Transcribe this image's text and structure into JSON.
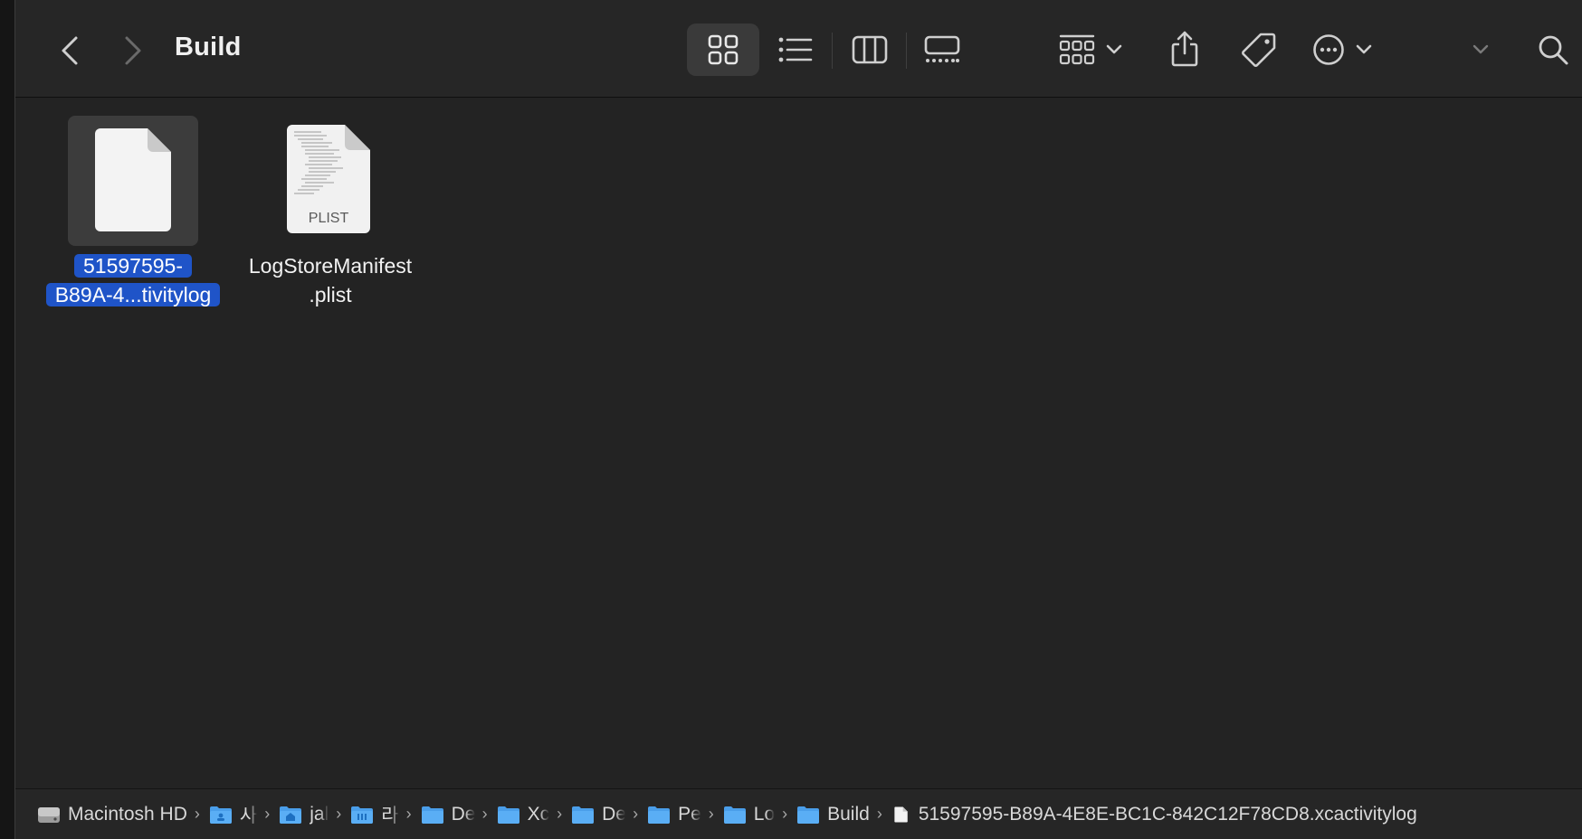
{
  "window": {
    "title": "Build"
  },
  "toolbar": {
    "icons": {
      "back": "chevron-left-icon",
      "forward": "chevron-right-icon",
      "icon_view": "grid-icon",
      "list_view": "list-icon",
      "column_view": "columns-icon",
      "gallery_view": "gallery-icon",
      "group": "group-icon",
      "share": "share-icon",
      "tags": "tag-icon",
      "action": "ellipsis-circle-icon",
      "more": "chevron-down-icon",
      "search": "search-icon"
    },
    "active_view": "icon_view"
  },
  "files": [
    {
      "name_line1": "51597595-",
      "name_line2": "B89A-4...tivitylog",
      "kind": "blank-document",
      "selected": true
    },
    {
      "name_line1": "LogStoreManifest",
      "name_line2": ".plist",
      "kind": "plist-document",
      "badge": "PLIST",
      "selected": false
    }
  ],
  "pathbar": {
    "items": [
      {
        "label": "Macintosh HD",
        "icon": "hard-drive-icon"
      },
      {
        "label": "사",
        "icon": "user-folder-icon"
      },
      {
        "label": "jal",
        "icon": "home-folder-icon"
      },
      {
        "label": "라",
        "icon": "library-folder-icon"
      },
      {
        "label": "De",
        "icon": "folder-icon"
      },
      {
        "label": "Xc",
        "icon": "folder-icon"
      },
      {
        "label": "De",
        "icon": "folder-icon"
      },
      {
        "label": "Pe",
        "icon": "folder-icon"
      },
      {
        "label": "Lo",
        "icon": "folder-icon"
      },
      {
        "label": "Build",
        "icon": "folder-icon"
      },
      {
        "label": "51597595-B89A-4E8E-BC1C-842C12F78CD8.xcactivitylog",
        "icon": "document-icon"
      }
    ]
  },
  "colors": {
    "selection": "#1f54c8",
    "folder_blue": "#4a9eea",
    "background": "#232323"
  }
}
